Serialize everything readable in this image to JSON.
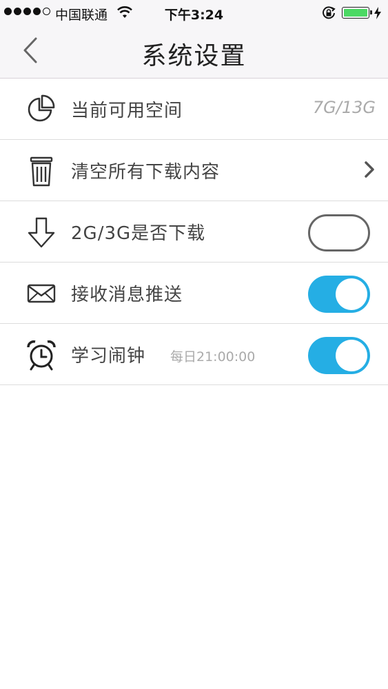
{
  "status_bar": {
    "carrier": "中国联通",
    "time": "下午3:24"
  },
  "nav": {
    "title": "系统设置"
  },
  "settings": [
    {
      "label": "当前可用空间",
      "value": "7G/13G",
      "icon": "pie-chart-icon"
    },
    {
      "label": "清空所有下载内容",
      "icon": "trash-icon",
      "accessory": "chevron-right-icon"
    },
    {
      "label": "2G/3G是否下载",
      "icon": "download-arrow-icon",
      "toggle": false
    },
    {
      "label": "接收消息推送",
      "icon": "envelope-icon",
      "toggle": true
    },
    {
      "label": "学习闹钟",
      "sub": "每日21:00:00",
      "icon": "alarm-clock-icon",
      "toggle": true
    }
  ],
  "colors": {
    "toggle_on": "#25aee4",
    "toggle_off_border": "#666666",
    "battery": "#4cd964",
    "bar_bg": "#f7f6f8"
  }
}
